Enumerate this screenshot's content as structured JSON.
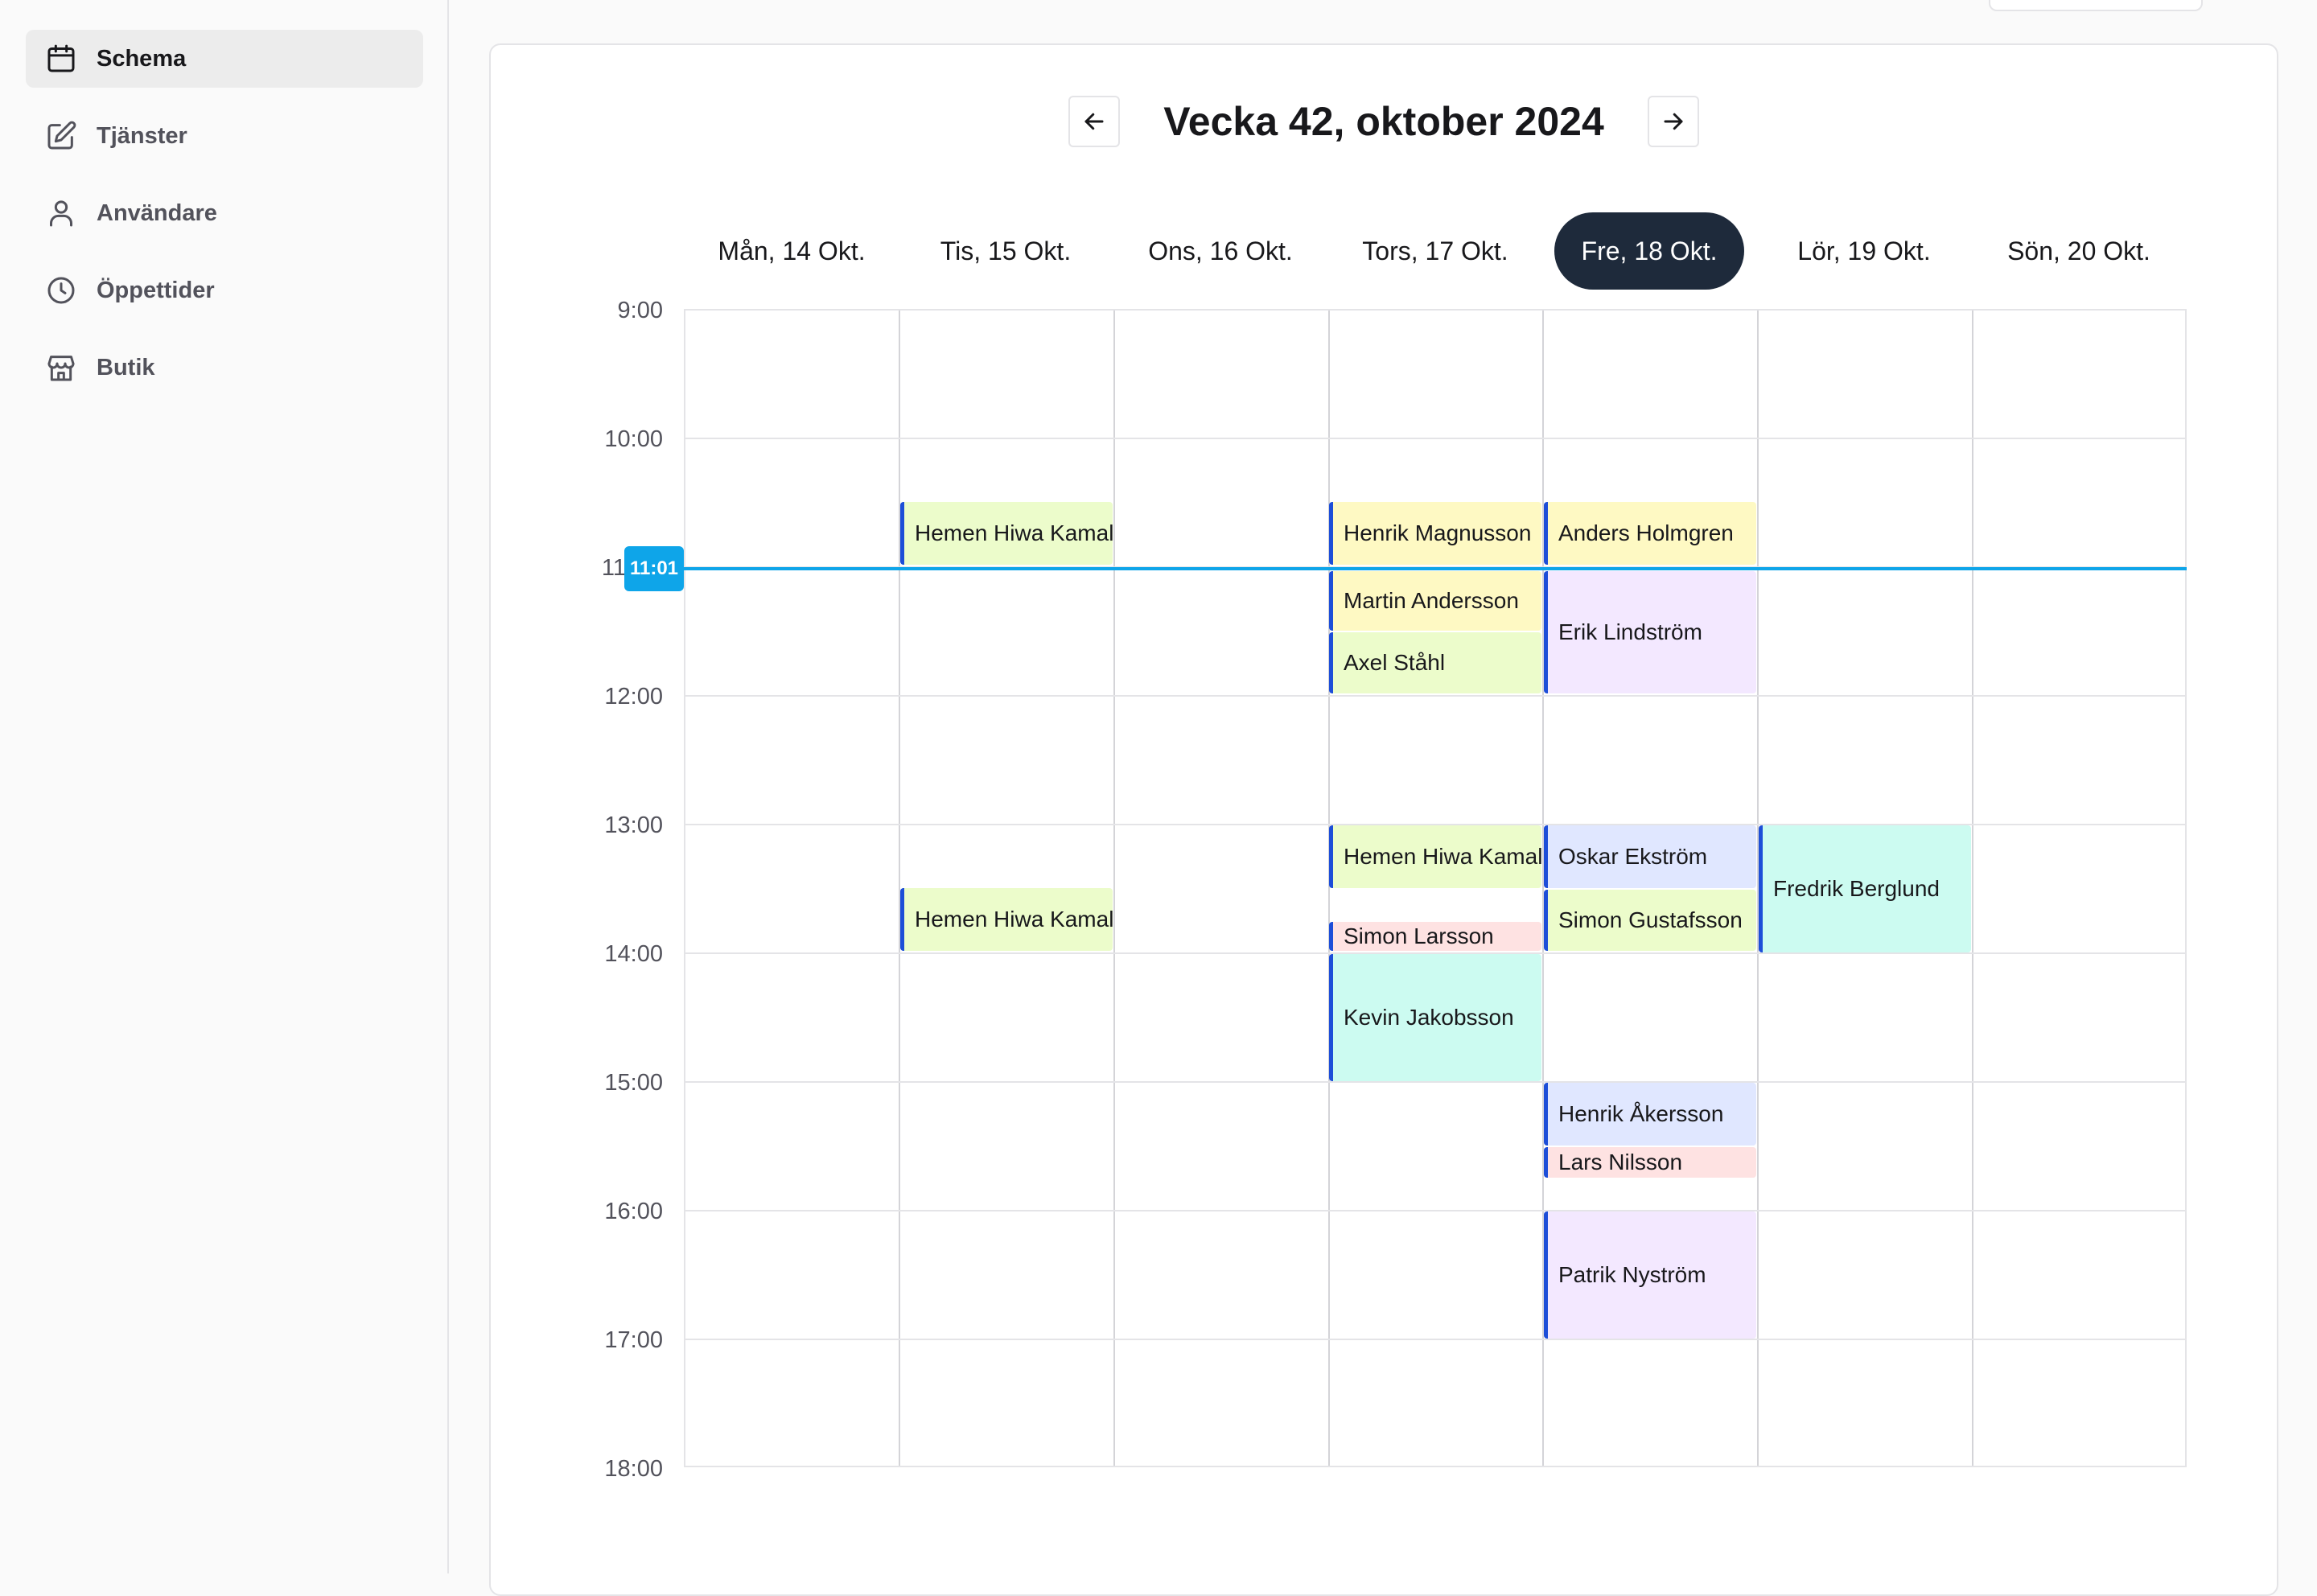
{
  "sidebar": {
    "items": [
      {
        "label": "Schema",
        "icon": "calendar-icon",
        "active": true
      },
      {
        "label": "Tjänster",
        "icon": "edit-icon"
      },
      {
        "label": "Användare",
        "icon": "user-icon"
      },
      {
        "label": "Öppettider",
        "icon": "clock-icon"
      },
      {
        "label": "Butik",
        "icon": "store-icon"
      }
    ]
  },
  "calendar": {
    "title": "Vecka 42, oktober 2024",
    "days": [
      "Mån, 14 Okt.",
      "Tis, 15 Okt.",
      "Ons, 16 Okt.",
      "Tors, 17 Okt.",
      "Fre, 18 Okt.",
      "Lör, 19 Okt.",
      "Sön, 20 Okt."
    ],
    "selected_day": "Fre, 18 Okt.",
    "hours": [
      "9:00",
      "10:00",
      "11",
      "12:00",
      "13:00",
      "14:00",
      "15:00",
      "16:00",
      "17:00",
      "18:00"
    ],
    "current_time": "11:01",
    "events": [
      {
        "name": "Hemen Hiwa Kamal"
      },
      {
        "name": "Hemen Hiwa Kamal"
      },
      {
        "name": "Henrik Magnusson"
      },
      {
        "name": "Martin Andersson"
      },
      {
        "name": "Axel Ståhl"
      },
      {
        "name": "Hemen Hiwa Kamal"
      },
      {
        "name": "Simon Larsson"
      },
      {
        "name": "Kevin Jakobsson"
      },
      {
        "name": "Anders Holmgren"
      },
      {
        "name": "Erik Lindström"
      },
      {
        "name": "Oskar Ekström"
      },
      {
        "name": "Simon Gustafsson"
      },
      {
        "name": "Henrik Åkersson"
      },
      {
        "name": "Lars Nilsson"
      },
      {
        "name": "Patrik Nyström"
      },
      {
        "name": "Fredrik Berglund"
      }
    ]
  },
  "colors": {
    "accent_now": "#0ea5e9",
    "selected_day_bg": "#1e2a3b",
    "event_border": "#1d4ed8"
  }
}
